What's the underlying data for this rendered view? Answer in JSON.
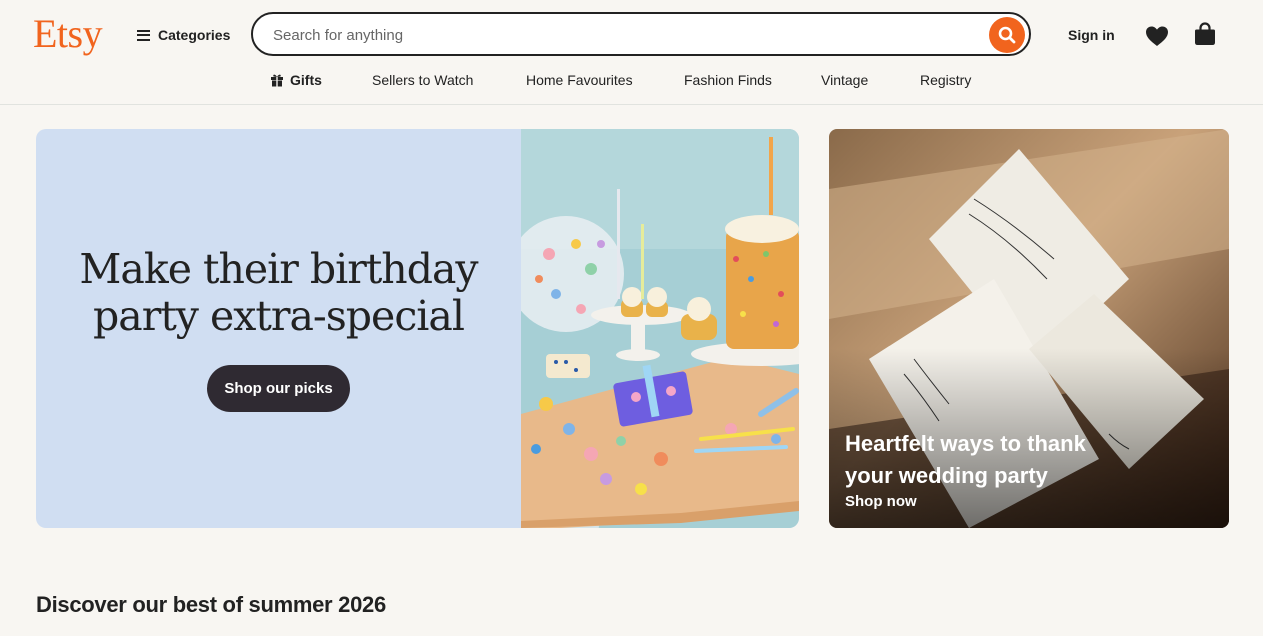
{
  "brand": {
    "logo": "Etsy",
    "accent": "#f1641e"
  },
  "header": {
    "categories_label": "Categories",
    "search_placeholder": "Search for anything",
    "search_value": "",
    "signin_label": "Sign in",
    "icons": [
      "menu-icon",
      "search-icon",
      "heart-icon",
      "shopping-bag-icon"
    ]
  },
  "subnav": [
    {
      "label": "Gifts",
      "icon": "gift-icon"
    },
    {
      "label": "Sellers to Watch"
    },
    {
      "label": "Home Favourites"
    },
    {
      "label": "Fashion Finds"
    },
    {
      "label": "Vintage"
    },
    {
      "label": "Registry"
    }
  ],
  "hero": {
    "title_line1": "Make their birthday",
    "title_line2": "party extra-special",
    "button_label": "Shop our picks",
    "background": "#d0def2"
  },
  "side_card": {
    "title_line1": "Heartfelt ways to thank",
    "title_line2": "your wedding party",
    "link_label": "Shop now"
  },
  "section": {
    "title": "Discover our best of summer 2026"
  }
}
